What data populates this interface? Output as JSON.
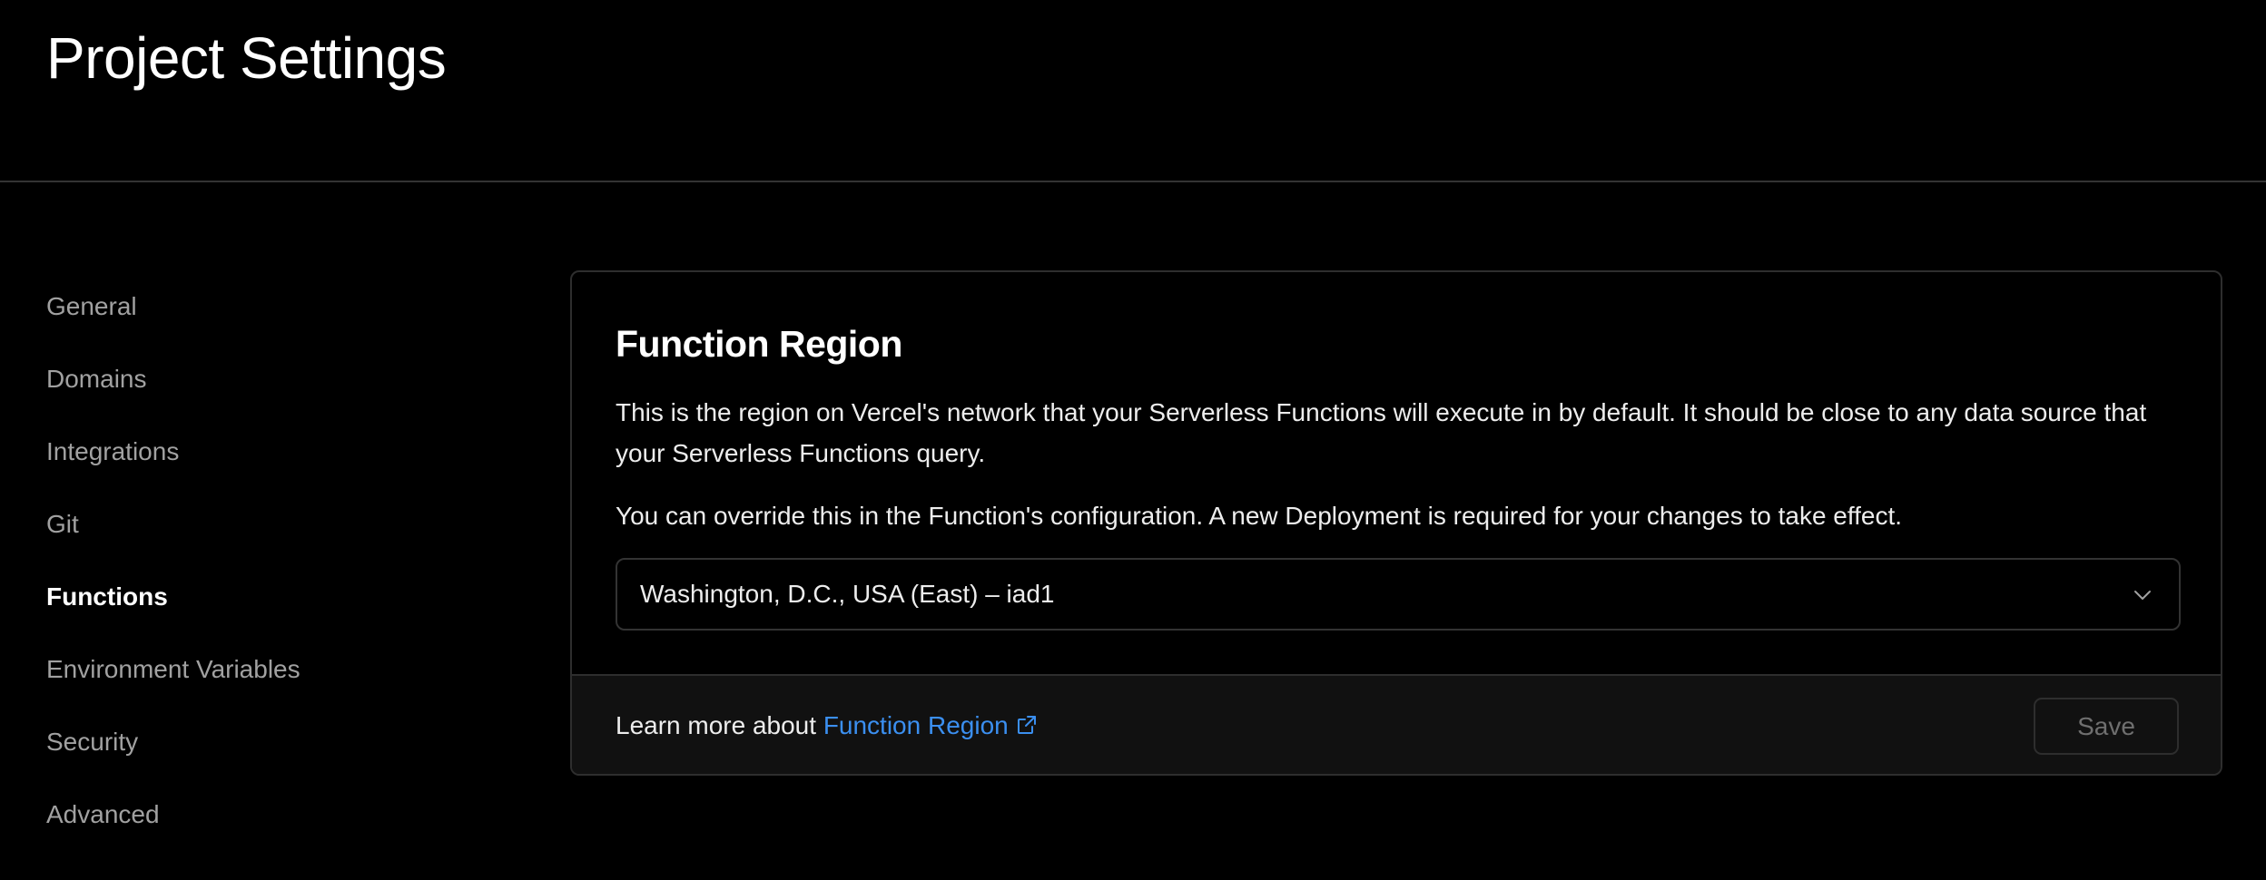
{
  "header": {
    "title": "Project Settings"
  },
  "sidebar": {
    "items": [
      {
        "label": "General",
        "active": false
      },
      {
        "label": "Domains",
        "active": false
      },
      {
        "label": "Integrations",
        "active": false
      },
      {
        "label": "Git",
        "active": false
      },
      {
        "label": "Functions",
        "active": true
      },
      {
        "label": "Environment Variables",
        "active": false
      },
      {
        "label": "Security",
        "active": false
      },
      {
        "label": "Advanced",
        "active": false
      }
    ]
  },
  "card": {
    "title": "Function Region",
    "description": "This is the region on Vercel's network that your Serverless Functions will execute in by default. It should be close to any data source that your Serverless Functions query.",
    "note": "You can override this in the Function's configuration. A new Deployment is required for your changes to take effect.",
    "region_select": {
      "selected": "Washington, D.C., USA (East) – iad1",
      "icon": "chevron-down-icon"
    },
    "footer": {
      "prefix": "Learn more about ",
      "link_label": "Function Region",
      "link_icon": "external-link-icon",
      "save_label": "Save",
      "save_disabled": true
    }
  },
  "colors": {
    "background": "#000000",
    "link": "#3b8ff0",
    "border": "#2e2e2e",
    "footer_background": "#111111",
    "muted_text": "#a1a1a1",
    "disabled_text": "#6f6f6f"
  }
}
